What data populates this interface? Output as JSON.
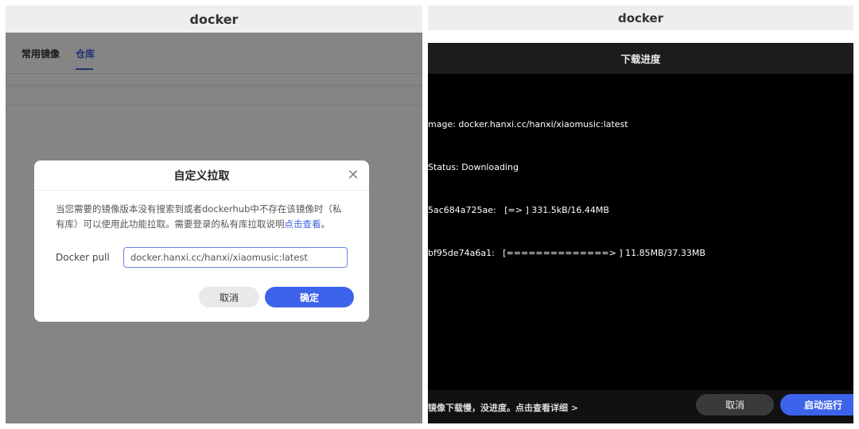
{
  "left": {
    "window_title": "docker",
    "tabs": [
      {
        "label": "常用镜像",
        "active": false
      },
      {
        "label": "仓库",
        "active": true
      }
    ],
    "dialog": {
      "title": "自定义拉取",
      "description": "当您需要的镜像版本没有搜索到或者dockerhub中不存在该镜像时（私有库）可以使用此功能拉取。需要登录的私有库拉取说明",
      "link_text": "点击查看",
      "description_end": "。",
      "pull_label": "Docker pull",
      "pull_value": "docker.hanxi.cc/hanxi/xiaomusic:latest",
      "cancel_label": "取消",
      "ok_label": "确定"
    }
  },
  "right": {
    "window_title": "docker",
    "panel_title": "下载进度",
    "log_lines": [
      "mage: docker.hanxi.cc/hanxi/xiaomusic:latest",
      "Status: Downloading",
      "5ac684a725ae:   [=> ] 331.5kB/16.44MB",
      "bf95de74a6a1:   [==============> ] 11.85MB/37.33MB"
    ],
    "footer_hint": "镜像下载慢，没进度。点击查看详细 >",
    "cancel_label": "取消",
    "start_label": "启动运行"
  },
  "colors": {
    "accent": "#3d63ea",
    "terminal_bg": "#000000"
  }
}
